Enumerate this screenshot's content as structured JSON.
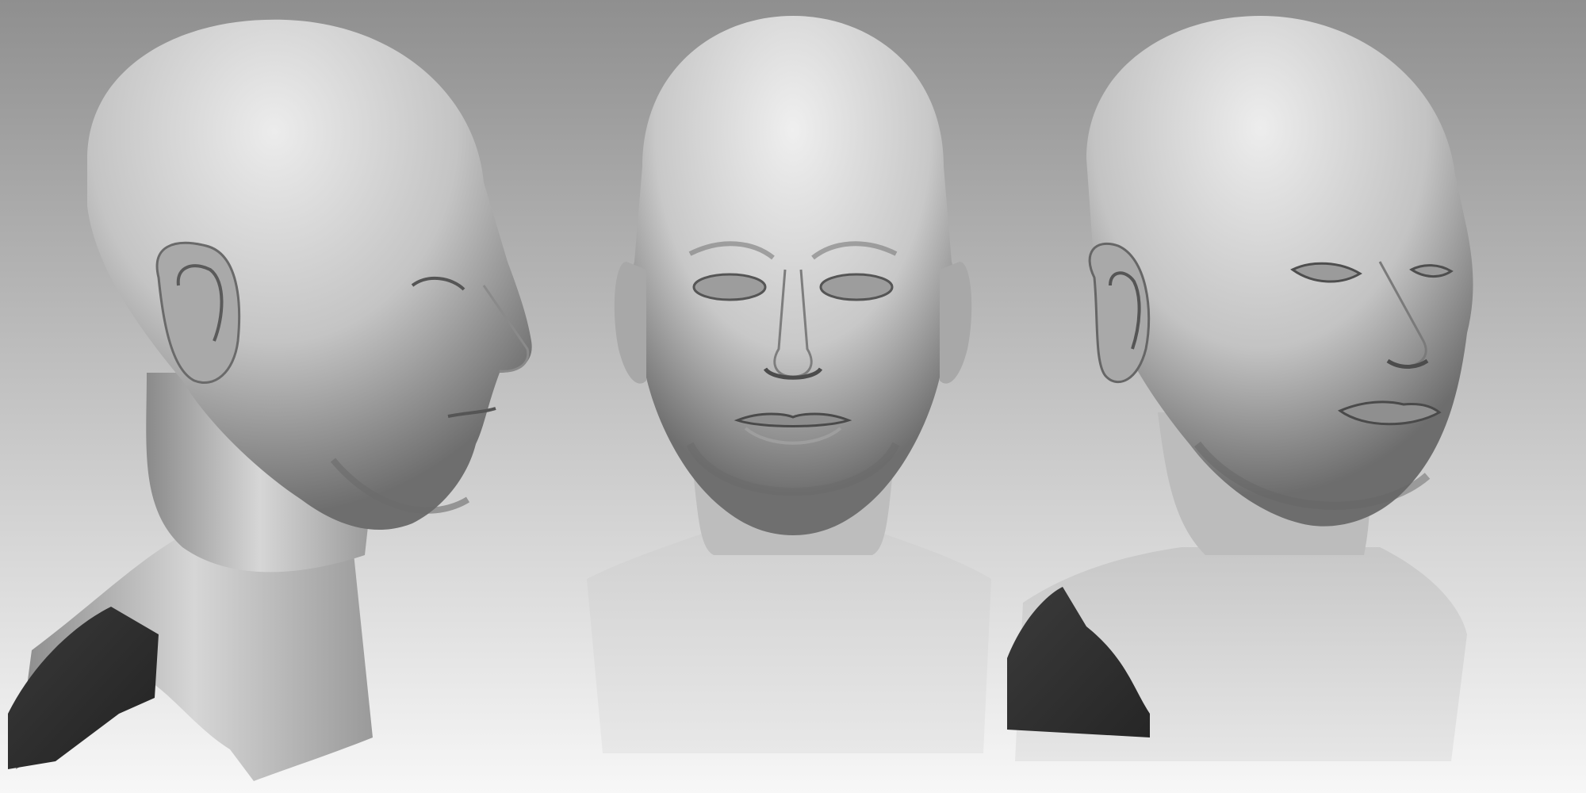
{
  "scene": {
    "background": {
      "top_color": "#8f8f8f",
      "bottom_color": "#f7f7f7"
    },
    "sculpt_colors": {
      "highlight": "#e9e9e9",
      "midtone": "#bdbdbd",
      "shadow": "#6f6f6f",
      "deep_shadow": "#3c3c3c",
      "backface": "#2e2e2e"
    },
    "views": [
      {
        "id": "view-left",
        "subject": "head-bust",
        "orientation": "profile-right"
      },
      {
        "id": "view-center",
        "subject": "head-bust",
        "orientation": "front"
      },
      {
        "id": "view-right",
        "subject": "head-bust",
        "orientation": "three-quarter-right"
      }
    ]
  }
}
